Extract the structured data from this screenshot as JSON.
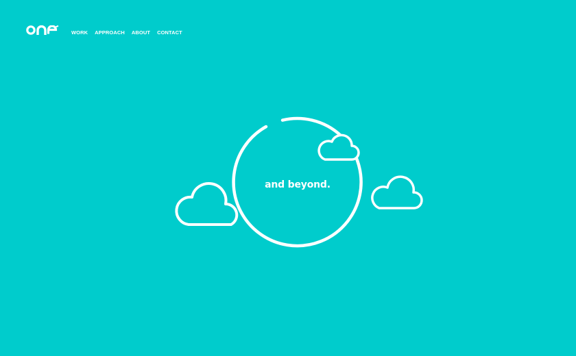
{
  "theme": {
    "background": "#00cccc",
    "foreground": "#ffffff"
  },
  "header": {
    "logo_label": "one",
    "nav": [
      {
        "label": "WORK"
      },
      {
        "label": "APPROACH"
      },
      {
        "label": "ABOUT"
      },
      {
        "label": "CONTACT"
      }
    ]
  },
  "hero": {
    "tagline": "and beyond.",
    "illustration": {
      "ring": "open-circle-outline",
      "clouds": [
        "cloud-outline-left",
        "cloud-outline-small-top-right",
        "cloud-outline-right"
      ]
    }
  }
}
